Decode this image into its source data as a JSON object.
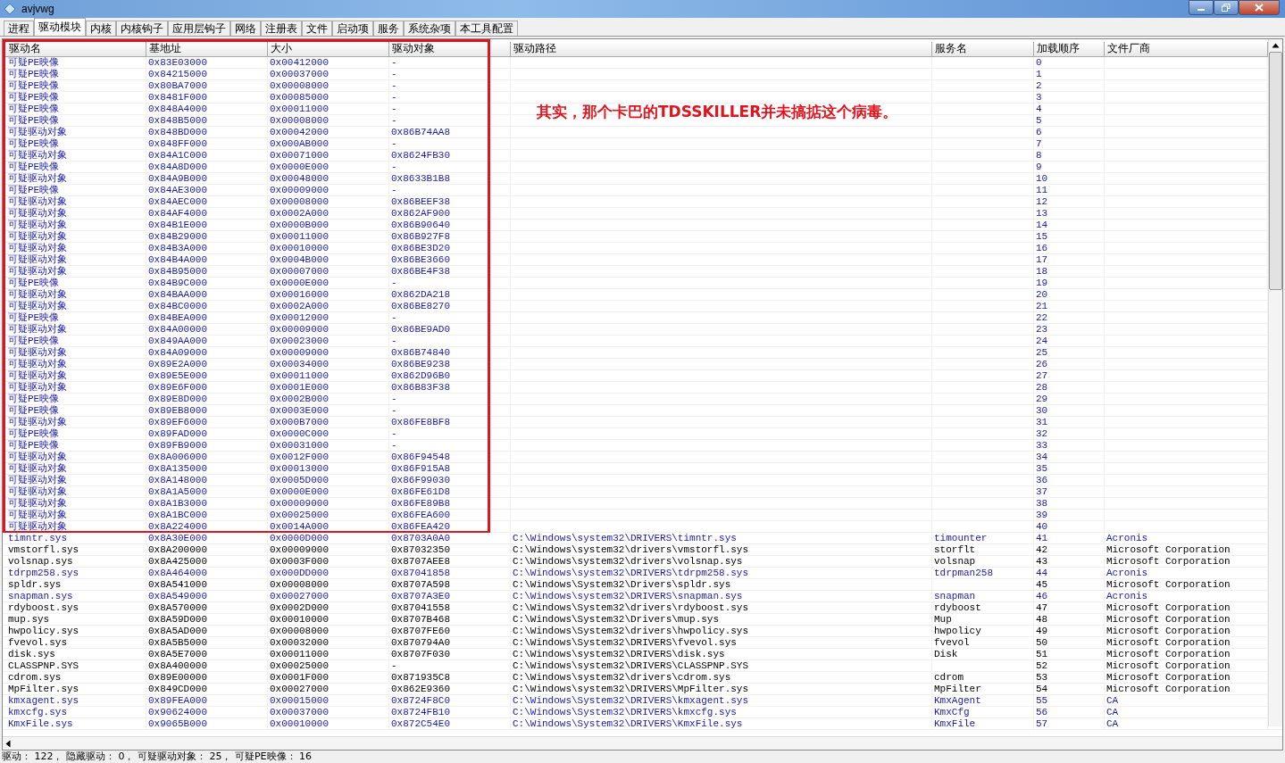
{
  "window": {
    "title": "avjvwg"
  },
  "tabs": [
    {
      "label": "进程",
      "selected": false
    },
    {
      "label": "驱动模块",
      "selected": true
    },
    {
      "label": "内核",
      "selected": false
    },
    {
      "label": "内核钩子",
      "selected": false
    },
    {
      "label": "应用层钩子",
      "selected": false
    },
    {
      "label": "网络",
      "selected": false
    },
    {
      "label": "注册表",
      "selected": false
    },
    {
      "label": "文件",
      "selected": false
    },
    {
      "label": "启动项",
      "selected": false
    },
    {
      "label": "服务",
      "selected": false
    },
    {
      "label": "系统杂项",
      "selected": false
    },
    {
      "label": "本工具配置",
      "selected": false
    }
  ],
  "table": {
    "columns": [
      "驱动名",
      "基地址",
      "大小",
      "驱动对象",
      "驱动路径",
      "服务名",
      "加载顺序",
      "文件厂商"
    ],
    "rows": [
      {
        "name": "可疑PE映像",
        "base": "0x83E03000",
        "size": "0x00412000",
        "object": "-",
        "order": "0",
        "flagged": true
      },
      {
        "name": "可疑PE映像",
        "base": "0x84215000",
        "size": "0x00037000",
        "object": "-",
        "order": "1",
        "flagged": true
      },
      {
        "name": "可疑PE映像",
        "base": "0x80BA7000",
        "size": "0x00008000",
        "object": "-",
        "order": "2",
        "flagged": true
      },
      {
        "name": "可疑PE映像",
        "base": "0x8481F000",
        "size": "0x00085000",
        "object": "-",
        "order": "3",
        "flagged": true
      },
      {
        "name": "可疑PE映像",
        "base": "0x848A4000",
        "size": "0x00011000",
        "object": "-",
        "order": "4",
        "flagged": true
      },
      {
        "name": "可疑PE映像",
        "base": "0x848B5000",
        "size": "0x00008000",
        "object": "-",
        "order": "5",
        "flagged": true
      },
      {
        "name": "可疑驱动对象",
        "base": "0x848BD000",
        "size": "0x00042000",
        "object": "0x86B74AA8",
        "order": "6",
        "flagged": true
      },
      {
        "name": "可疑PE映像",
        "base": "0x848FF000",
        "size": "0x000AB000",
        "object": "-",
        "order": "7",
        "flagged": true
      },
      {
        "name": "可疑驱动对象",
        "base": "0x84A1C000",
        "size": "0x00071000",
        "object": "0x8624FB30",
        "order": "8",
        "flagged": true
      },
      {
        "name": "可疑PE映像",
        "base": "0x84A8D000",
        "size": "0x0000E000",
        "object": "-",
        "order": "9",
        "flagged": true
      },
      {
        "name": "可疑驱动对象",
        "base": "0x84A9B000",
        "size": "0x00048000",
        "object": "0x8633B1B8",
        "order": "10",
        "flagged": true
      },
      {
        "name": "可疑PE映像",
        "base": "0x84AE3000",
        "size": "0x00009000",
        "object": "-",
        "order": "11",
        "flagged": true
      },
      {
        "name": "可疑驱动对象",
        "base": "0x84AEC000",
        "size": "0x00008000",
        "object": "0x86BEEF38",
        "order": "12",
        "flagged": true
      },
      {
        "name": "可疑驱动对象",
        "base": "0x84AF4000",
        "size": "0x0002A000",
        "object": "0x862AF900",
        "order": "13",
        "flagged": true
      },
      {
        "name": "可疑驱动对象",
        "base": "0x84B1E000",
        "size": "0x0000B000",
        "object": "0x86B90640",
        "order": "14",
        "flagged": true
      },
      {
        "name": "可疑驱动对象",
        "base": "0x84B29000",
        "size": "0x00011000",
        "object": "0x86B927F8",
        "order": "15",
        "flagged": true
      },
      {
        "name": "可疑驱动对象",
        "base": "0x84B3A000",
        "size": "0x00010000",
        "object": "0x86BE3D20",
        "order": "16",
        "flagged": true
      },
      {
        "name": "可疑驱动对象",
        "base": "0x84B4A000",
        "size": "0x0004B000",
        "object": "0x86BE3660",
        "order": "17",
        "flagged": true
      },
      {
        "name": "可疑驱动对象",
        "base": "0x84B95000",
        "size": "0x00007000",
        "object": "0x86BE4F38",
        "order": "18",
        "flagged": true
      },
      {
        "name": "可疑PE映像",
        "base": "0x84B9C000",
        "size": "0x0000E000",
        "object": "-",
        "order": "19",
        "flagged": true
      },
      {
        "name": "可疑驱动对象",
        "base": "0x84BAA000",
        "size": "0x00016000",
        "object": "0x862DA218",
        "order": "20",
        "flagged": true
      },
      {
        "name": "可疑驱动对象",
        "base": "0x84BC0000",
        "size": "0x0002A000",
        "object": "0x86BE8270",
        "order": "21",
        "flagged": true
      },
      {
        "name": "可疑PE映像",
        "base": "0x84BEA000",
        "size": "0x00012000",
        "object": "-",
        "order": "22",
        "flagged": true
      },
      {
        "name": "可疑驱动对象",
        "base": "0x84A00000",
        "size": "0x00009000",
        "object": "0x86BE9AD0",
        "order": "23",
        "flagged": true
      },
      {
        "name": "可疑PE映像",
        "base": "0x849AA000",
        "size": "0x00023000",
        "object": "-",
        "order": "24",
        "flagged": true
      },
      {
        "name": "可疑驱动对象",
        "base": "0x84A09000",
        "size": "0x00009000",
        "object": "0x86B74840",
        "order": "25",
        "flagged": true
      },
      {
        "name": "可疑驱动对象",
        "base": "0x89E2A000",
        "size": "0x00034000",
        "object": "0x86BE9238",
        "order": "26",
        "flagged": true
      },
      {
        "name": "可疑驱动对象",
        "base": "0x89E5E000",
        "size": "0x00011000",
        "object": "0x862D96B0",
        "order": "27",
        "flagged": true
      },
      {
        "name": "可疑驱动对象",
        "base": "0x89E6F000",
        "size": "0x0001E000",
        "object": "0x86B83F38",
        "order": "28",
        "flagged": true
      },
      {
        "name": "可疑PE映像",
        "base": "0x89E8D000",
        "size": "0x0002B000",
        "object": "-",
        "order": "29",
        "flagged": true
      },
      {
        "name": "可疑PE映像",
        "base": "0x89EB8000",
        "size": "0x0003E000",
        "object": "-",
        "order": "30",
        "flagged": true
      },
      {
        "name": "可疑驱动对象",
        "base": "0x89EF6000",
        "size": "0x000B7000",
        "object": "0x86FE8BF8",
        "order": "31",
        "flagged": true
      },
      {
        "name": "可疑PE映像",
        "base": "0x89FAD000",
        "size": "0x0000C000",
        "object": "-",
        "order": "32",
        "flagged": true
      },
      {
        "name": "可疑PE映像",
        "base": "0x89FB9000",
        "size": "0x00031000",
        "object": "-",
        "order": "33",
        "flagged": true
      },
      {
        "name": "可疑驱动对象",
        "base": "0x8A006000",
        "size": "0x0012F000",
        "object": "0x86F94548",
        "order": "34",
        "flagged": true
      },
      {
        "name": "可疑驱动对象",
        "base": "0x8A135000",
        "size": "0x00013000",
        "object": "0x86F915A8",
        "order": "35",
        "flagged": true
      },
      {
        "name": "可疑驱动对象",
        "base": "0x8A148000",
        "size": "0x0005D000",
        "object": "0x86F99030",
        "order": "36",
        "flagged": true
      },
      {
        "name": "可疑驱动对象",
        "base": "0x8A1A5000",
        "size": "0x0000E000",
        "object": "0x86FE61D8",
        "order": "37",
        "flagged": true
      },
      {
        "name": "可疑驱动对象",
        "base": "0x8A1B3000",
        "size": "0x00009000",
        "object": "0x86FE89B8",
        "order": "38",
        "flagged": true
      },
      {
        "name": "可疑驱动对象",
        "base": "0x8A1BC000",
        "size": "0x00025000",
        "object": "0x86FEA600",
        "order": "39",
        "flagged": true
      },
      {
        "name": "可疑驱动对象",
        "base": "0x8A224000",
        "size": "0x0014A000",
        "object": "0x86FEA420",
        "order": "40",
        "flagged": true
      },
      {
        "name": "timntr.sys",
        "base": "0x8A30E000",
        "size": "0x0000D000",
        "object": "0x8703A0A0",
        "path": "C:\\Windows\\system32\\DRIVERS\\timntr.sys",
        "service": "timounter",
        "order": "41",
        "vendor": "Acronis",
        "flagged": true
      },
      {
        "name": "vmstorfl.sys",
        "base": "0x8A200000",
        "size": "0x00009000",
        "object": "0x87032350",
        "path": "C:\\Windows\\system32\\drivers\\vmstorfl.sys",
        "service": "storflt",
        "order": "42",
        "vendor": "Microsoft Corporation",
        "flagged": false
      },
      {
        "name": "volsnap.sys",
        "base": "0x8A425000",
        "size": "0x0003F000",
        "object": "0x8707AEE8",
        "path": "C:\\Windows\\system32\\drivers\\volsnap.sys",
        "service": "volsnap",
        "order": "43",
        "vendor": "Microsoft Corporation",
        "flagged": false
      },
      {
        "name": "tdrpm258.sys",
        "base": "0x8A464000",
        "size": "0x000DD000",
        "object": "0x87041858",
        "path": "C:\\Windows\\system32\\DRIVERS\\tdrpm258.sys",
        "service": "tdrpman258",
        "order": "44",
        "vendor": "Acronis",
        "flagged": true
      },
      {
        "name": "spldr.sys",
        "base": "0x8A541000",
        "size": "0x00008000",
        "object": "0x8707A598",
        "path": "C:\\Windows\\System32\\Drivers\\spldr.sys",
        "order": "45",
        "vendor": "Microsoft Corporation",
        "flagged": false
      },
      {
        "name": "snapman.sys",
        "base": "0x8A549000",
        "size": "0x00027000",
        "object": "0x8707A3E0",
        "path": "C:\\Windows\\system32\\DRIVERS\\snapman.sys",
        "service": "snapman",
        "order": "46",
        "vendor": "Acronis",
        "flagged": true
      },
      {
        "name": "rdyboost.sys",
        "base": "0x8A570000",
        "size": "0x0002D000",
        "object": "0x87041558",
        "path": "C:\\Windows\\System32\\drivers\\rdyboost.sys",
        "service": "rdyboost",
        "order": "47",
        "vendor": "Microsoft Corporation",
        "flagged": false
      },
      {
        "name": "mup.sys",
        "base": "0x8A59D000",
        "size": "0x00010000",
        "object": "0x8707B468",
        "path": "C:\\Windows\\System32\\Drivers\\mup.sys",
        "service": "Mup",
        "order": "48",
        "vendor": "Microsoft Corporation",
        "flagged": false
      },
      {
        "name": "hwpolicy.sys",
        "base": "0x8A5AD000",
        "size": "0x00008000",
        "object": "0x8707FE60",
        "path": "C:\\Windows\\System32\\drivers\\hwpolicy.sys",
        "service": "hwpolicy",
        "order": "49",
        "vendor": "Microsoft Corporation",
        "flagged": false
      },
      {
        "name": "fvevol.sys",
        "base": "0x8A5B5000",
        "size": "0x00032000",
        "object": "0x870794A0",
        "path": "C:\\Windows\\System32\\DRIVERS\\fvevol.sys",
        "service": "fvevol",
        "order": "50",
        "vendor": "Microsoft Corporation",
        "flagged": false
      },
      {
        "name": "disk.sys",
        "base": "0x8A5E7000",
        "size": "0x00011000",
        "object": "0x8707F030",
        "path": "C:\\Windows\\system32\\DRIVERS\\disk.sys",
        "service": "Disk",
        "order": "51",
        "vendor": "Microsoft Corporation",
        "flagged": false
      },
      {
        "name": "CLASSPNP.SYS",
        "base": "0x8A400000",
        "size": "0x00025000",
        "object": "-",
        "path": "C:\\Windows\\system32\\DRIVERS\\CLASSPNP.SYS",
        "order": "52",
        "vendor": "Microsoft Corporation",
        "flagged": false
      },
      {
        "name": "cdrom.sys",
        "base": "0x89E00000",
        "size": "0x0001F000",
        "object": "0x871935C8",
        "path": "C:\\Windows\\system32\\drivers\\cdrom.sys",
        "service": "cdrom",
        "order": "53",
        "vendor": "Microsoft Corporation",
        "flagged": false
      },
      {
        "name": "MpFilter.sys",
        "base": "0x849CD000",
        "size": "0x00027000",
        "object": "0x862E9360",
        "path": "C:\\Windows\\system32\\DRIVERS\\MpFilter.sys",
        "service": "MpFilter",
        "order": "54",
        "vendor": "Microsoft Corporation",
        "flagged": false
      },
      {
        "name": "kmxagent.sys",
        "base": "0x89FEA000",
        "size": "0x00015000",
        "object": "0x8724F8C0",
        "path": "C:\\Windows\\System32\\DRIVERS\\kmxagent.sys",
        "service": "KmxAgent",
        "order": "55",
        "vendor": "CA",
        "flagged": true
      },
      {
        "name": "kmxcfg.sys",
        "base": "0x90624000",
        "size": "0x00037000",
        "object": "0x8724FB10",
        "path": "C:\\Windows\\System32\\DRIVERS\\kmxcfg.sys",
        "service": "KmxCfg",
        "order": "56",
        "vendor": "CA",
        "flagged": true
      },
      {
        "name": "KmxFile.sys",
        "base": "0x9065B000",
        "size": "0x00010000",
        "object": "0x872C54E0",
        "path": "C:\\Windows\\System32\\DRIVERS\\KmxFile.sys",
        "service": "KmxFile",
        "order": "57",
        "vendor": "CA",
        "flagged": true
      }
    ]
  },
  "annotation": "其实，那个卡巴的TDSSKILLER并未搞掂这个病毒。",
  "status_bar": "驱动： 122， 隐藏驱动： 0， 可疑驱动对象： 25， 可疑PE映像： 16"
}
